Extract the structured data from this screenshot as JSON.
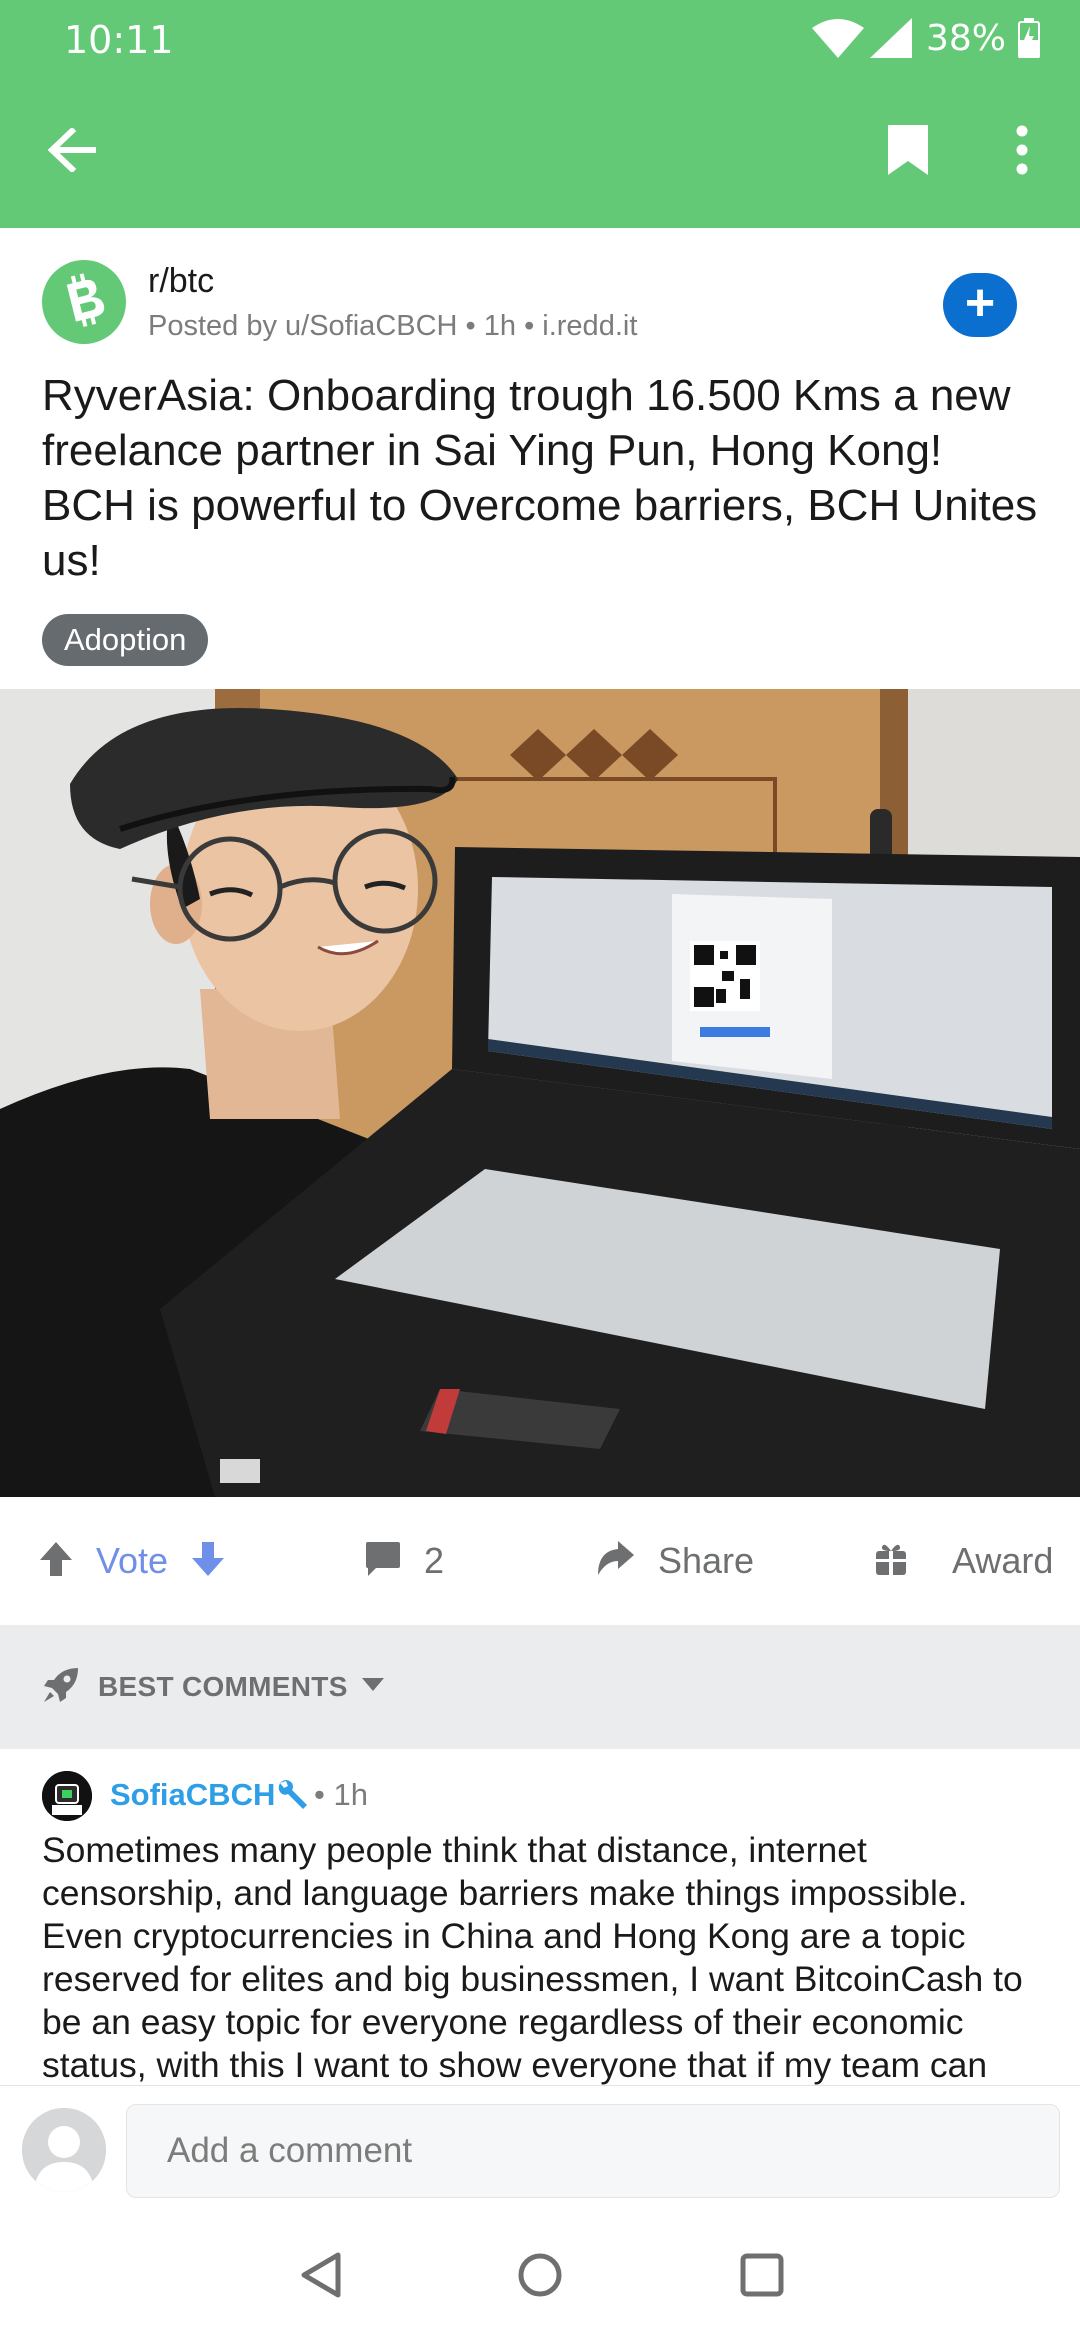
{
  "status_bar": {
    "time": "10:11",
    "battery": "38%"
  },
  "app_bar": {
    "back_icon": "arrow-left-icon",
    "bookmark_icon": "bookmark-icon",
    "overflow_icon": "more-vert-icon"
  },
  "post": {
    "subreddit": "r/btc",
    "subreddit_icon": "bitcoin-cash-icon",
    "meta": "Posted by u/SofiaCBCH • 1h • i.redd.it",
    "title": "RyverAsia: Onboarding trough 16.500 Kms a new freelance partner in Sai Ying Pun, Hong Kong! BCH is powerful to Overcome barriers, BCH Unites us!",
    "flair": "Adoption",
    "join_icon": "plus-icon"
  },
  "actions": {
    "vote_label": "Vote",
    "comment_count": "2",
    "share_label": "Share",
    "award_label": "Award"
  },
  "sort": {
    "label": "BEST COMMENTS",
    "icon": "rocket-icon"
  },
  "comment": {
    "author": "SofiaCBCH",
    "time": "• 1h",
    "body": "Sometimes many people think that distance, internet censorship, and language barriers make things impossible. Even cryptocurrencies in China and Hong Kong are a topic reserved for elites and big businessmen, I want BitcoinCash to be an easy topic for everyone regardless of their economic status, with this I want to show everyone that if my team can"
  },
  "composer": {
    "placeholder": "Add a comment"
  },
  "colors": {
    "accent": "#63c977",
    "join": "#0a6fcf",
    "upvote": "#6f8fe8",
    "author": "#2e9ee6"
  }
}
